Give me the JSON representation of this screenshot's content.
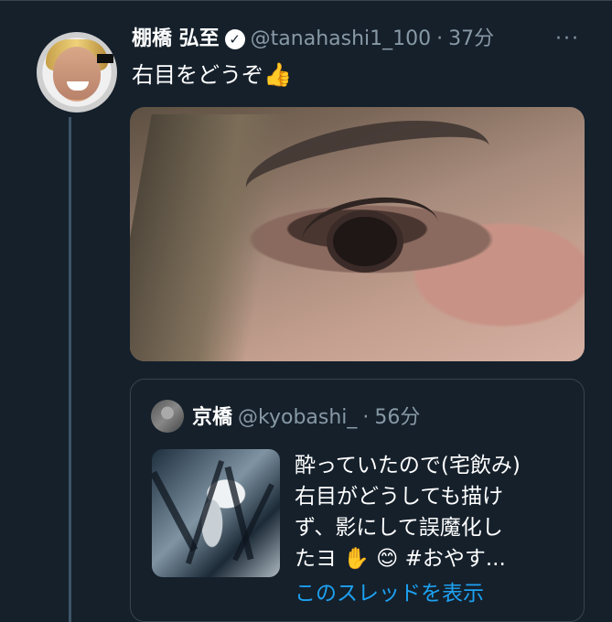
{
  "tweet": {
    "name": "棚橋 弘至",
    "verified_icon": "verified-check-icon",
    "handle": "@tanahashi1_100",
    "separator": "·",
    "time": "37分",
    "more": "···",
    "text": "右目をどうぞ",
    "emoji": "👍"
  },
  "quote": {
    "name": "京橋",
    "handle": "@kyobashi_",
    "separator": "·",
    "time": "56分",
    "text_line1": "酔っていたので(宅飲み)",
    "text_line2": "右目がどうしても描け",
    "text_line3": "ず、影にして誤魔化し",
    "text_line4_prefix": "たヨ",
    "text_line4_emoji1": "✋",
    "text_line4_emoji2": "😊",
    "text_line4_hashtag": "#おやす...",
    "show_thread": "このスレッドを表示"
  },
  "colors": {
    "background": "#15202b",
    "border": "#38444d",
    "secondary_text": "#8899a6",
    "link": "#1da1f2"
  }
}
